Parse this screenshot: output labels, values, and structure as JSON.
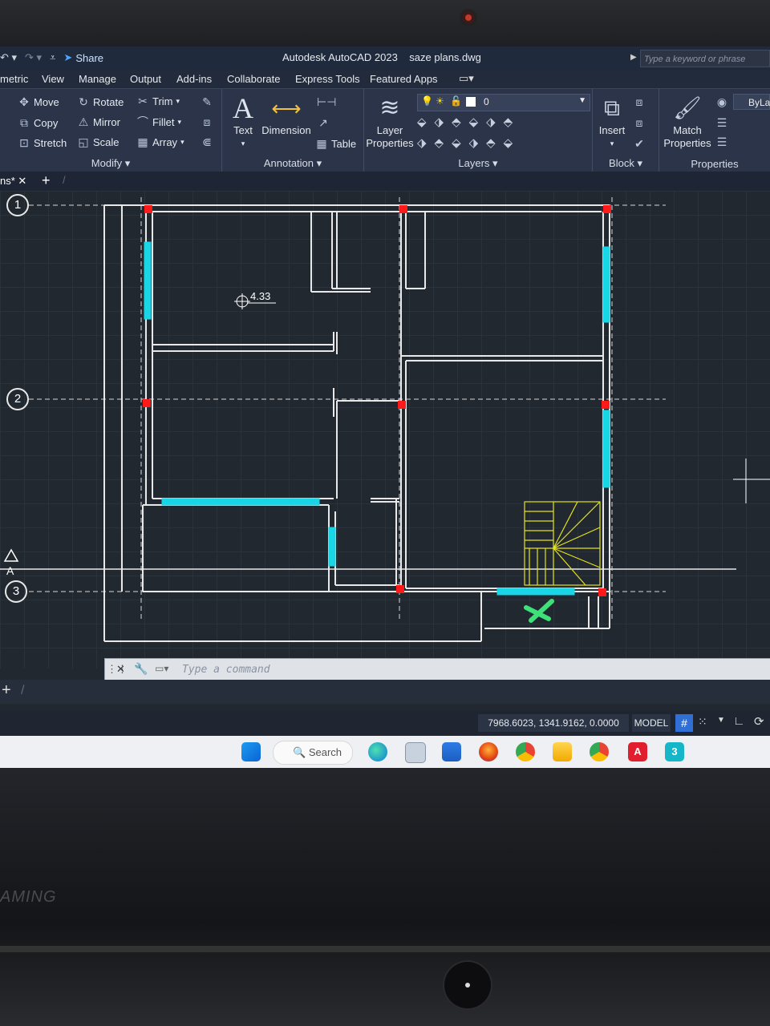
{
  "titlebar": {
    "share_label": "Share",
    "title": "Autodesk AutoCAD 2023",
    "filename": "saze plans.dwg",
    "search_placeholder": "Type a keyword or phrase"
  },
  "menu_tabs": [
    "metric",
    "View",
    "Manage",
    "Output",
    "Add-ins",
    "Collaborate",
    "Express Tools",
    "Featured Apps"
  ],
  "ribbon": {
    "modify": {
      "title": "Modify",
      "tools": [
        "Move",
        "Rotate",
        "Trim",
        "Copy",
        "Mirror",
        "Fillet",
        "Stretch",
        "Scale",
        "Array"
      ]
    },
    "annotation": {
      "title": "Annotation",
      "text_label": "Text",
      "dimension_label": "Dimension",
      "table_label": "Table"
    },
    "layers": {
      "title": "Layers",
      "layer_properties_label_1": "Layer",
      "layer_properties_label_2": "Properties",
      "current_layer": "0"
    },
    "block": {
      "title": "Block",
      "insert_label": "Insert"
    },
    "properties": {
      "title": "Properties",
      "match_label_1": "Match",
      "match_label_2": "Properties",
      "bylayer": "ByLa"
    }
  },
  "doc_tab": {
    "label": "ns*"
  },
  "drawing": {
    "grid_labels": [
      "1",
      "2",
      "3"
    ],
    "axis_label": "A",
    "dimension_text": "4.33"
  },
  "command_line": {
    "placeholder": "Type a command"
  },
  "status": {
    "coordinates": "7968.6023, 1341.9162, 0.0000",
    "model_label": "MODEL"
  },
  "taskbar": {
    "search_label": "Search"
  },
  "laptop": {
    "brand_text": "AMING"
  },
  "colors": {
    "wall": "#e8e8e8",
    "window": "#19d6e6",
    "column": "#ff1a1a",
    "stairs": "#e6e21c",
    "marker": "#3ee07a",
    "canvas": "#212830"
  }
}
